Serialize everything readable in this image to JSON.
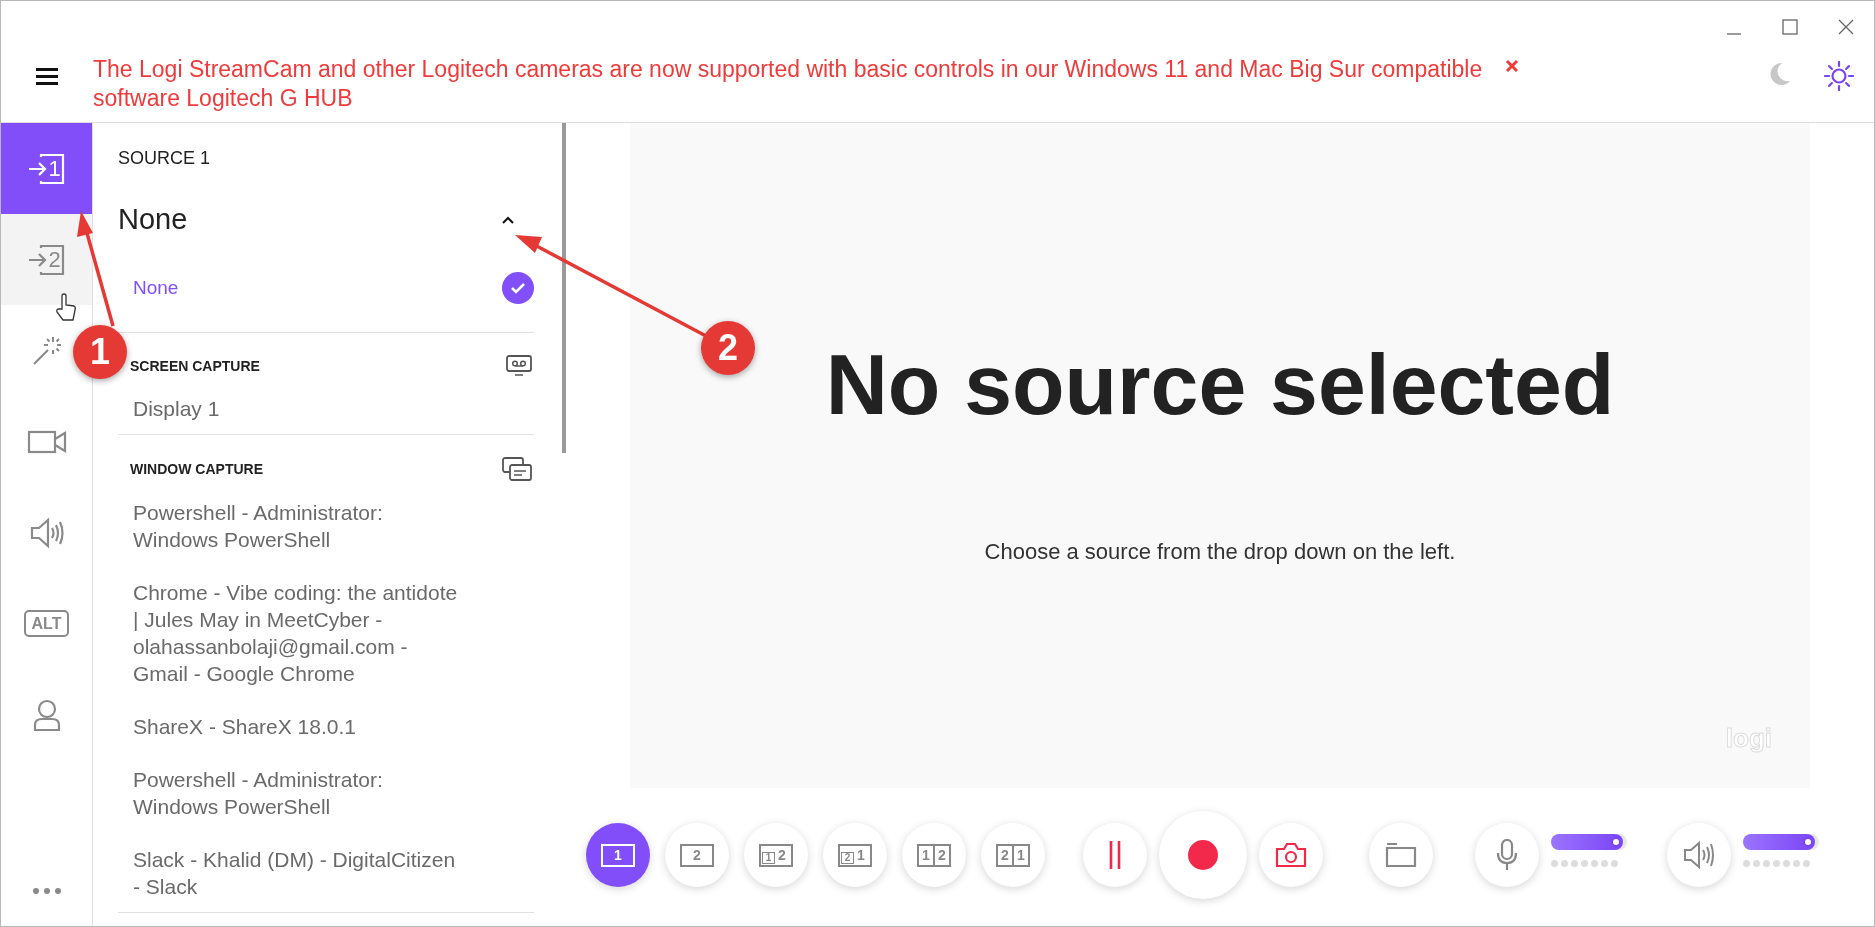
{
  "banner": {
    "message": "The Logi StreamCam and other Logitech cameras are now supported with basic controls in our Windows 11 and Mac Big Sur compatible software Logitech G HUB"
  },
  "theme": [
    {
      "kind": "dark",
      "selected": false
    },
    {
      "kind": "light",
      "selected": true
    }
  ],
  "nav": [
    {
      "kind": "source",
      "digit": "1",
      "selected": true,
      "hovered": false
    },
    {
      "kind": "source",
      "digit": "2",
      "selected": false,
      "hovered": true
    },
    {
      "kind": "effects",
      "selected": false,
      "hovered": false
    },
    {
      "kind": "camera",
      "selected": false,
      "hovered": false
    },
    {
      "kind": "audio",
      "selected": false,
      "hovered": false
    },
    {
      "kind": "alt",
      "label": "ALT",
      "selected": false,
      "hovered": false
    },
    {
      "kind": "account",
      "selected": false,
      "hovered": false
    },
    {
      "kind": "more",
      "selected": false,
      "hovered": false
    }
  ],
  "source": {
    "title": "SOURCE 1",
    "value": "None",
    "expanded": true,
    "options": [
      {
        "label": "None",
        "selected": true
      }
    ],
    "sections": [
      {
        "kind": "screen",
        "title": "SCREEN CAPTURE",
        "items": [
          {
            "label": "Display 1",
            "selected": false
          }
        ]
      },
      {
        "kind": "window",
        "title": "WINDOW CAPTURE",
        "items": [
          {
            "label": "Powershell - Administrator: Windows PowerShell",
            "selected": false
          },
          {
            "label": "Chrome - Vibe coding: the antidote | Jules May in MeetCyber - olahassanbolaji@gmail.com - Gmail - Google Chrome",
            "selected": false
          },
          {
            "label": "ShareX - ShareX 18.0.1",
            "selected": false
          },
          {
            "label": "Powershell - Administrator: Windows PowerShell",
            "selected": false
          },
          {
            "label": "Slack - Khalid (DM) - DigitalCitizen - Slack",
            "selected": false
          }
        ]
      }
    ]
  },
  "preview": {
    "title": "No source selected",
    "hint": "Choose a source from the drop down on the left.",
    "logo": "logi"
  },
  "layouts": [
    {
      "kind": "single",
      "digits": [
        "1"
      ],
      "selected": true
    },
    {
      "kind": "single",
      "digits": [
        "2"
      ],
      "selected": false
    },
    {
      "kind": "pip",
      "digits": [
        "1",
        "2"
      ],
      "selected": false
    },
    {
      "kind": "pip",
      "digits": [
        "2",
        "1"
      ],
      "selected": false
    },
    {
      "kind": "split",
      "digits": [
        "1",
        "2"
      ],
      "selected": false
    },
    {
      "kind": "split",
      "digits": [
        "2",
        "1"
      ],
      "selected": false
    }
  ],
  "audio": [
    {
      "kind": "mic",
      "level": 0.95
    },
    {
      "kind": "speaker",
      "level": 0.95
    }
  ],
  "annotations": [
    {
      "label": "1"
    },
    {
      "label": "2"
    }
  ]
}
